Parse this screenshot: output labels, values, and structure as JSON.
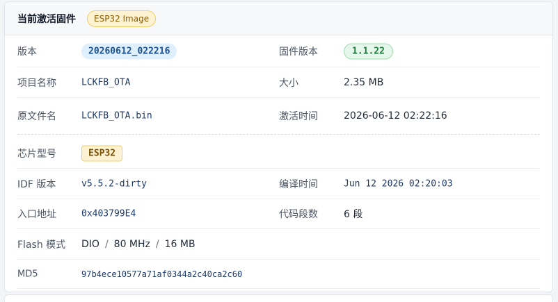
{
  "header": {
    "title": "当前激活固件",
    "badge": "ESP32 Image"
  },
  "rows": {
    "version": {
      "label": "版本",
      "value": "20260612_022216"
    },
    "firmware_version": {
      "label": "固件版本",
      "value": "1.1.22"
    },
    "project_name": {
      "label": "项目名称",
      "value": "LCKFB_OTA"
    },
    "size": {
      "label": "大小",
      "value": "2.35 MB"
    },
    "original_filename": {
      "label": "原文件名",
      "value": "LCKFB_OTA.bin"
    },
    "activated_time": {
      "label": "激活时间",
      "value": "2026-06-12 02:22:16"
    },
    "chip_model": {
      "label": "芯片型号",
      "value": "ESP32"
    },
    "idf_version": {
      "label": "IDF 版本",
      "value": "v5.5.2-dirty"
    },
    "compile_time": {
      "label": "编译时间",
      "value": "Jun 12 2026 02:20:03"
    },
    "entry_address": {
      "label": "入口地址",
      "value": "0x403799E4"
    },
    "code_segments": {
      "label": "代码段数",
      "value": "6 段"
    },
    "flash_mode": {
      "label": "Flash 模式",
      "mode": "DIO",
      "freq": "80 MHz",
      "size": "16 MB",
      "separator": "/"
    },
    "md5": {
      "label": "MD5",
      "value": "97b4ece10577a71af0344a2c40ca2c60"
    }
  },
  "colors": {
    "pill_blue_bg": "#dff0fc",
    "pill_green_bg": "#e5f6ea",
    "pill_yellow_bg": "#fdf3d3"
  }
}
